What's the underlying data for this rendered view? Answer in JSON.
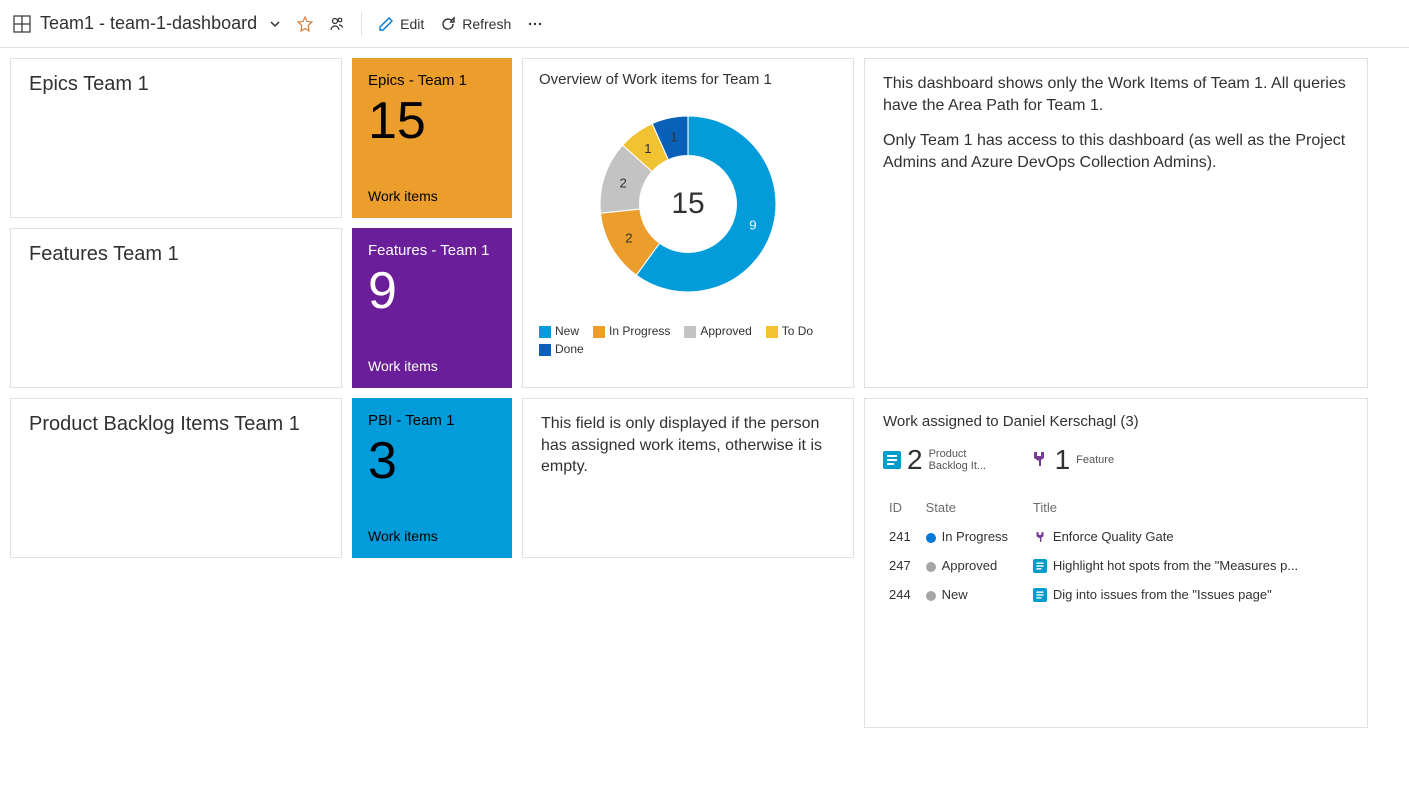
{
  "header": {
    "title": "Team1 - team-1-dashboard",
    "edit": "Edit",
    "refresh": "Refresh"
  },
  "tiles": {
    "epics_title": "Epics Team 1",
    "features_title": "Features Team 1",
    "pbi_title": "Product Backlog Items Team 1",
    "epics": {
      "title": "Epics - Team 1",
      "count": "15",
      "unit": "Work items"
    },
    "features": {
      "title": "Features - Team 1",
      "count": "9",
      "unit": "Work items"
    },
    "pbi": {
      "title": "PBI - Team 1",
      "count": "3",
      "unit": "Work items"
    }
  },
  "chart_data": {
    "type": "pie",
    "title": "Overview of Work items for Team 1",
    "total": "15",
    "series": [
      {
        "name": "New",
        "value": 9,
        "color": "#029cda"
      },
      {
        "name": "In Progress",
        "value": 2,
        "color": "#eb9e2c"
      },
      {
        "name": "Approved",
        "value": 2,
        "color": "#c3c3c3"
      },
      {
        "name": "To Do",
        "value": 1,
        "color": "#f1c232"
      },
      {
        "name": "Done",
        "value": 1,
        "color": "#0860b8"
      }
    ]
  },
  "info": {
    "p1": "This dashboard shows only the Work Items of Team 1. All queries have the Area Path for Team 1.",
    "p2": "Only Team 1 has access to this dashboard (as well as the Project Admins and Azure DevOps Collection Admins)."
  },
  "note": {
    "text": "This field is only displayed if the person has assigned work items, otherwise it is empty."
  },
  "assigned": {
    "title": "Work assigned to Daniel Kerschagl (3)",
    "summary": {
      "pbi_count": "2",
      "pbi_label": "Product Backlog It...",
      "feature_count": "1",
      "feature_label": "Feature"
    },
    "columns": {
      "id": "ID",
      "state": "State",
      "title": "Title"
    },
    "state_colors": {
      "In Progress": "#0078d4",
      "Approved": "#a6a6a6",
      "New": "#a6a6a6"
    },
    "rows": [
      {
        "id": "241",
        "state": "In Progress",
        "type": "feature",
        "title": "Enforce Quality Gate"
      },
      {
        "id": "247",
        "state": "Approved",
        "type": "pbi",
        "title": "Highlight hot spots from the \"Measures p..."
      },
      {
        "id": "244",
        "state": "New",
        "type": "pbi",
        "title": "Dig into issues from the \"Issues page\""
      }
    ]
  }
}
